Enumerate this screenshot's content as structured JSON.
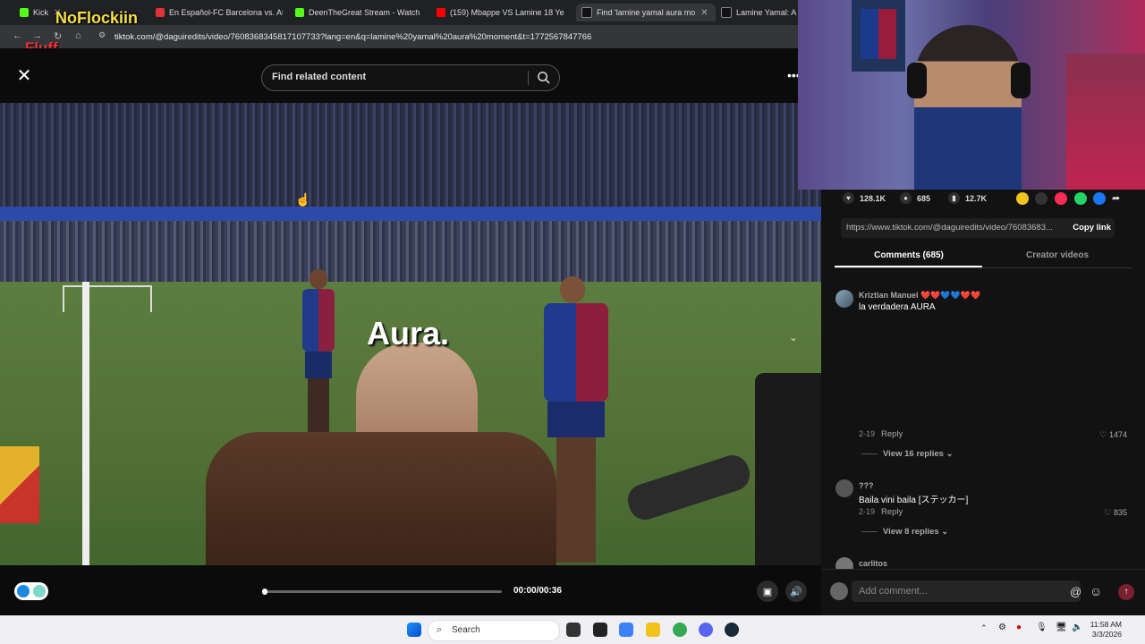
{
  "browser": {
    "tabs": [
      {
        "label": "Kick",
        "color": "#53fc18"
      },
      {
        "label": "En Español-FC Barcelona vs. Atl",
        "color": "#d33"
      },
      {
        "label": "DeenTheGreat Stream - Watch",
        "color": "#53fc18"
      },
      {
        "label": "(159) Mbappe VS Lamine 18 Ye",
        "color": "#ff0000"
      },
      {
        "label": "Find 'lamine yamal aura mo",
        "color": "#000000"
      },
      {
        "label": "Lamine Yamal: A Ge",
        "color": "#000000"
      }
    ],
    "url": "tiktok.com/@daguiredits/video/7608368345817107733?lang=en&q=lamine%20yamal%20aura%20moment&t=1772567847766"
  },
  "overlay": {
    "brand": "NoFlockiin",
    "brand2": "Fluff"
  },
  "player": {
    "search_placeholder": "Find related content",
    "caption": "Aura.",
    "time": "00:00/00:36",
    "progress_fraction": 0.01
  },
  "stats": {
    "likes": "128.1K",
    "comments": "685",
    "saves": "12.7K"
  },
  "share": {
    "link": "https://www.tiktok.com/@daguiredits/video/76083683...",
    "copy_label": "Copy link"
  },
  "tabs": {
    "comments": "Comments (685)",
    "creator": "Creator videos"
  },
  "comments": [
    {
      "name": "Kriztian Manuel ❤️❤️💙💙❤️❤️",
      "text": "la verdadera AURA",
      "date": "2-19",
      "reply": "Reply",
      "likes": "1474",
      "replies": "View 16 replies"
    },
    {
      "name": "???",
      "text": "Baila vini baila [ステッカー]",
      "date": "2-19",
      "reply": "Reply",
      "likes": "835",
      "replies": "View 8 replies"
    },
    {
      "name": "carlitos",
      "text": "",
      "date": "",
      "reply": "",
      "likes": "",
      "replies": ""
    }
  ],
  "add_comment": {
    "placeholder": "Add comment..."
  },
  "taskbar": {
    "search": "Search",
    "time": "11:58 AM",
    "date": "3/3/2026"
  }
}
